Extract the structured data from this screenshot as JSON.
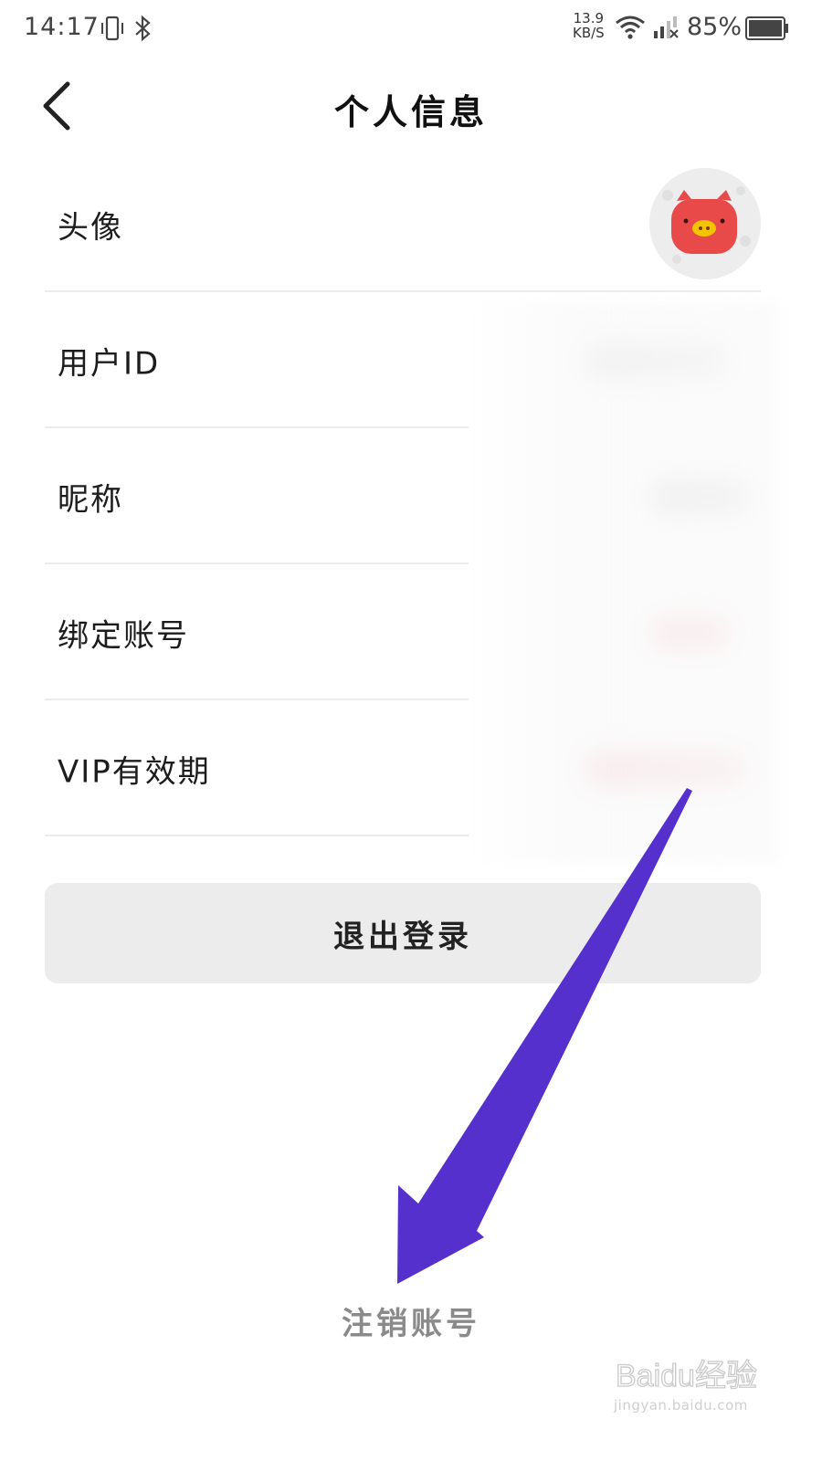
{
  "status_bar": {
    "time": "14:17",
    "net_speed_value": "13.9",
    "net_speed_unit": "KB/S",
    "battery_percent": "85%"
  },
  "header": {
    "title": "个人信息"
  },
  "rows": [
    {
      "label": "头像"
    },
    {
      "label": "用户ID"
    },
    {
      "label": "昵称"
    },
    {
      "label": "绑定账号"
    },
    {
      "label": "VIP有效期"
    }
  ],
  "logout_label": "退出登录",
  "cancel_account_label": "注销账号",
  "annotation_arrow_color": "#5530cc",
  "avatar_bg_color": "#e84a4a",
  "watermark": {
    "logo_text": "Baidu经验",
    "url": "jingyan.baidu.com"
  }
}
